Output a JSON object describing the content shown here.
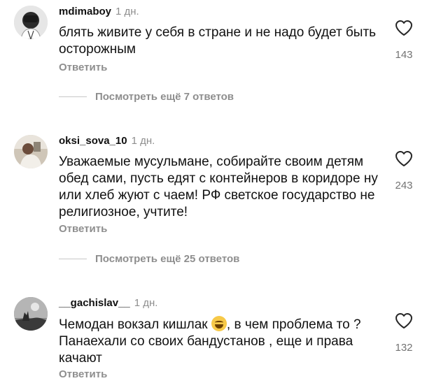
{
  "comments": [
    {
      "username": "mdimaboy",
      "time": "1 дн.",
      "text": "блять живите у себя в стране и не надо будет быть осторожным",
      "likes": "143",
      "reply_label": "Ответить",
      "more_replies": "Посмотреть ещё 7 ответов"
    },
    {
      "username": "oksi_sova_10",
      "time": "1 дн.",
      "text": "Уважаемые мусульмане, собирайте своим детям обед сами, пусть едят с контейнеров в коридоре ну или хлеб жуют с чаем! РФ светское государство не религиозное, учтите!",
      "likes": "243",
      "reply_label": "Ответить",
      "more_replies": "Посмотреть ещё 25 ответов"
    },
    {
      "username": "__gachislav__",
      "time": "1 дн.",
      "text_before_emoji": "Чемодан вокзал кишлак ",
      "emoji": "face-with-tears-of-joy-emoji",
      "text_after_emoji": ", в чем проблема то ? Панаехали со своих бандустанов , еще и права качают",
      "likes": "132",
      "reply_label": "Ответить"
    }
  ],
  "icons": {
    "like": "heart-outline-icon"
  }
}
